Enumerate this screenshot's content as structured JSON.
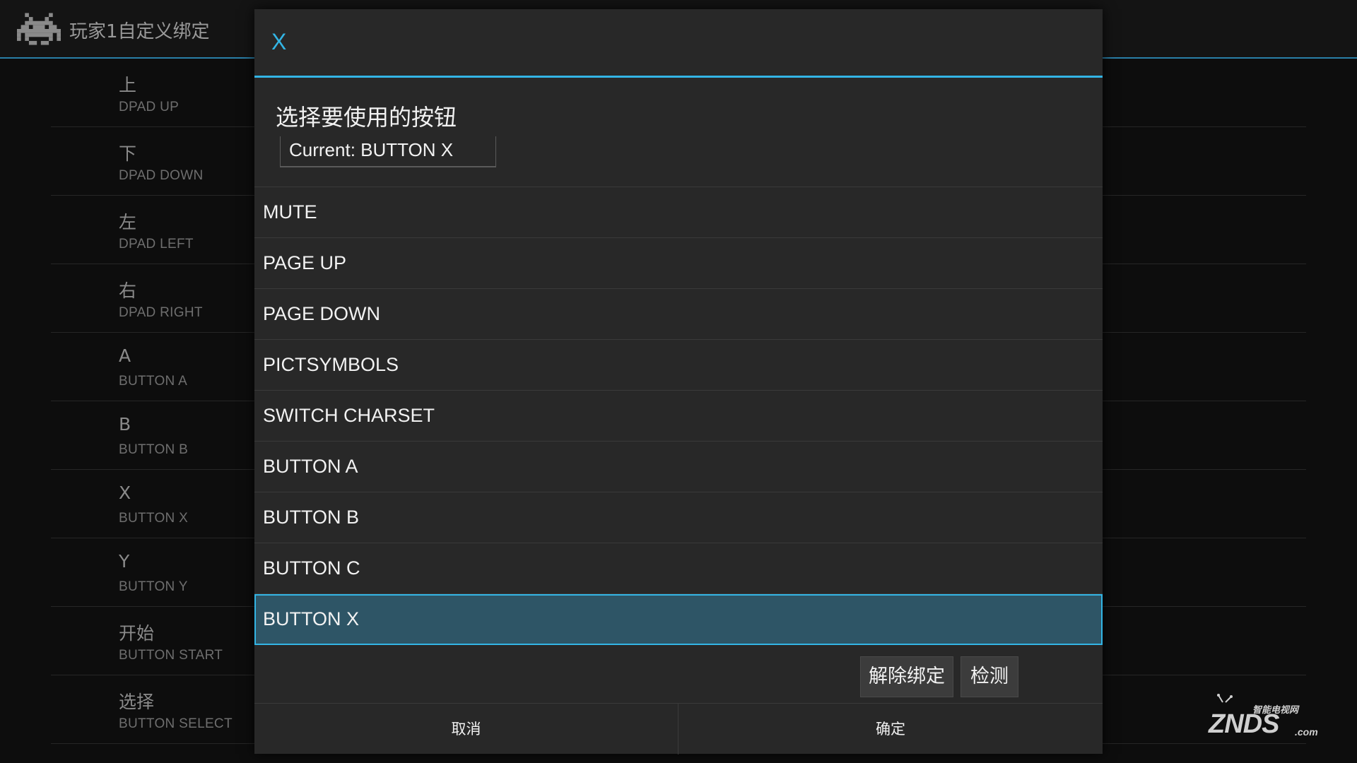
{
  "app": {
    "title": "玩家1自定义绑定"
  },
  "bindings": [
    {
      "name": "上",
      "key": "DPAD UP"
    },
    {
      "name": "下",
      "key": "DPAD DOWN"
    },
    {
      "name": "左",
      "key": "DPAD LEFT"
    },
    {
      "name": "右",
      "key": "DPAD RIGHT"
    },
    {
      "name": "A",
      "key": "BUTTON A"
    },
    {
      "name": "B",
      "key": "BUTTON B"
    },
    {
      "name": "X",
      "key": "BUTTON X"
    },
    {
      "name": "Y",
      "key": "BUTTON Y"
    },
    {
      "name": "开始",
      "key": "BUTTON START"
    },
    {
      "name": "选择",
      "key": "BUTTON SELECT"
    }
  ],
  "dialog": {
    "title": "X",
    "message": "选择要使用的按钮",
    "current": "Current: BUTTON X",
    "options": [
      "MUTE",
      "PAGE UP",
      "PAGE DOWN",
      "PICTSYMBOLS",
      "SWITCH CHARSET",
      "BUTTON A",
      "BUTTON B",
      "BUTTON C",
      "BUTTON X"
    ],
    "selected_option": "BUTTON X",
    "unbind_label": "解除绑定",
    "detect_label": "检测",
    "cancel_label": "取消",
    "ok_label": "确定"
  },
  "watermark": {
    "top": "智能电视网",
    "main": "ZNDS",
    "suffix": ".com"
  },
  "colors": {
    "accent": "#33b5e5",
    "selected_bg": "#2e5566",
    "dialog_bg": "#282828",
    "background": "#0d0d0d"
  },
  "icons": {
    "app": "space-invader-icon",
    "watermark": "tv-icon"
  }
}
